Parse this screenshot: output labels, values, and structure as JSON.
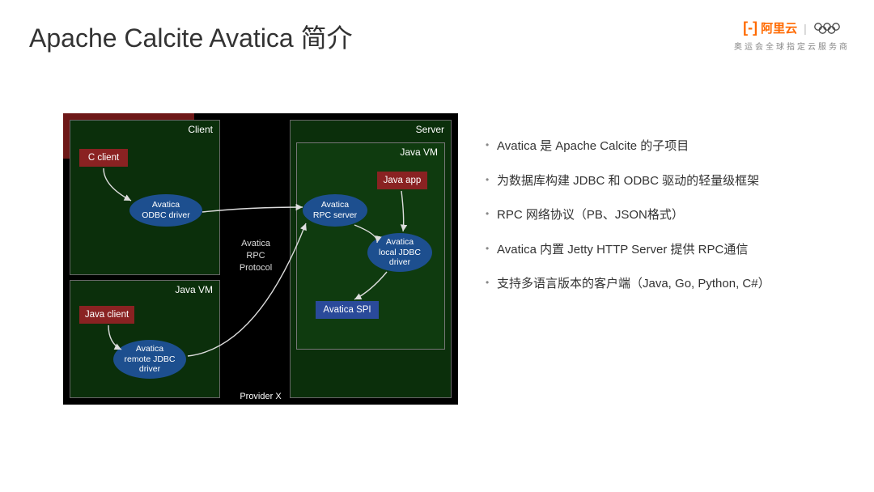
{
  "title": "Apache Calcite Avatica 简介",
  "logo": {
    "brand": "阿里云",
    "subtitle": "奥运会全球指定云服务商"
  },
  "diagram": {
    "boxes": {
      "client": "Client",
      "java_vm_client": "Java VM",
      "server": "Server",
      "java_vm_server": "Java VM",
      "provider_x": "Provider X"
    },
    "rect_nodes": {
      "c_client": "C client",
      "java_client": "Java client",
      "java_app": "Java app",
      "avatica_spi": "Avatica SPI"
    },
    "ellipse_nodes": {
      "odbc_driver": "Avatica\nODBC driver",
      "remote_jdbc": "Avatica\nremote JDBC\ndriver",
      "rpc_server": "Avatica\nRPC server",
      "local_jdbc": "Avatica\nlocal JDBC\ndriver"
    },
    "protocol": "Avatica\nRPC\nProtocol"
  },
  "bullets": [
    "Avatica 是 Apache Calcite 的子项目",
    "为数据库构建 JDBC 和 ODBC 驱动的轻量级框架",
    "RPC 网络协议（PB、JSON格式）",
    "Avatica 内置 Jetty HTTP Server 提供 RPC通信",
    "支持多语言版本的客户端（Java, Go, Python, C#）"
  ]
}
